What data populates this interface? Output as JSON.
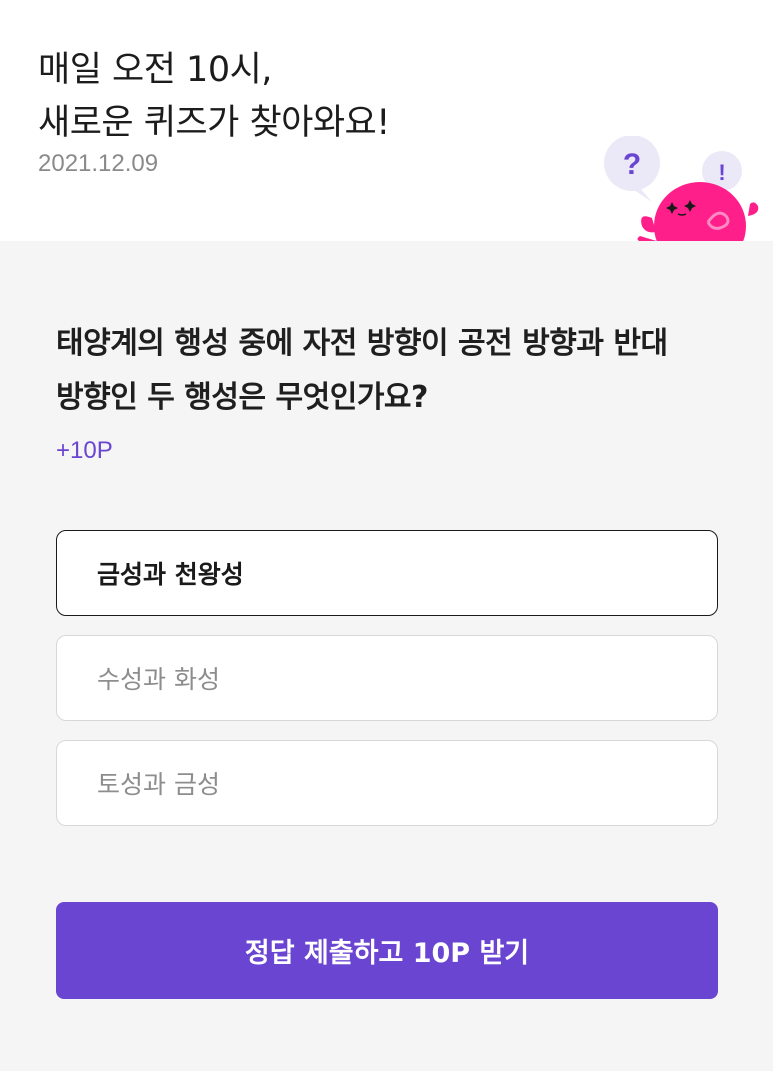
{
  "header": {
    "title_line1": "매일 오전 10시,",
    "title_line2": "새로운 퀴즈가 찾아와요!",
    "date": "2021.12.09"
  },
  "mascot": {
    "bubble_question": "?",
    "bubble_exclaim": "!"
  },
  "quiz": {
    "question_line1": "태양계의 행성 중에 자전 방향이 공전 방향과 반대",
    "question_line2": "방향인 두 행성은 무엇인가요?",
    "points": "+10P",
    "options": [
      {
        "label": "금성과 천왕성",
        "selected": true
      },
      {
        "label": "수성과 화성",
        "selected": false
      },
      {
        "label": "토성과 금성",
        "selected": false
      }
    ],
    "submit_label": "정답 제출하고 10P 받기"
  },
  "colors": {
    "accent": "#6a45d1",
    "mascot": "#ff1f8a",
    "bubble": "#ebe9f7",
    "background": "#f5f5f5"
  },
  "icons": {
    "mascot": "pink-blob-character-icon",
    "bubble_left": "question-bubble-icon",
    "bubble_right": "exclamation-bubble-icon"
  }
}
